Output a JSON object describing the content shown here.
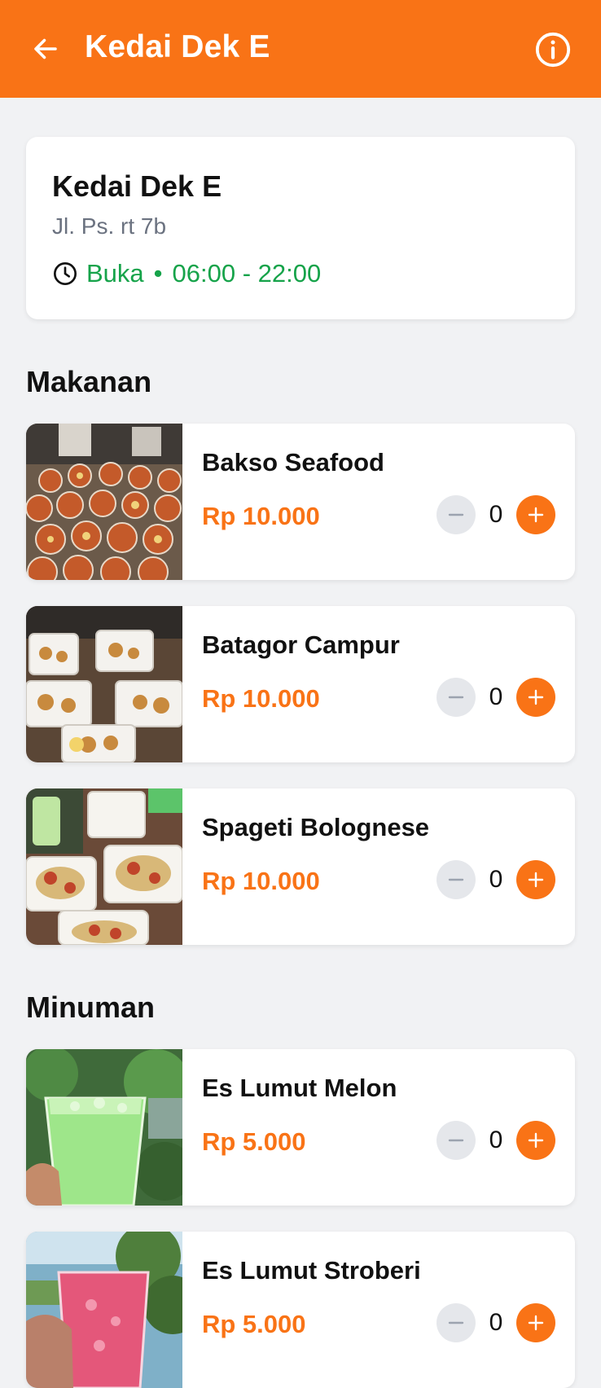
{
  "appbar": {
    "title": "Kedai Dek E",
    "back_icon": "arrow-left-icon",
    "info_icon": "info-circle-icon",
    "color": "#f97316"
  },
  "store": {
    "name": "Kedai Dek E",
    "address": "Jl. Ps. rt 7b",
    "status": "Buka",
    "separator": "•",
    "hours": "06:00 - 22:00",
    "status_color": "#16a34a"
  },
  "sections": [
    {
      "title": "Makanan",
      "items": [
        {
          "name": "Bakso Seafood",
          "price": "Rp 10.000",
          "qty": "0"
        },
        {
          "name": "Batagor Campur",
          "price": "Rp 10.000",
          "qty": "0"
        },
        {
          "name": "Spageti Bolognese",
          "price": "Rp 10.000",
          "qty": "0"
        }
      ]
    },
    {
      "title": "Minuman",
      "items": [
        {
          "name": "Es Lumut Melon",
          "price": "Rp 5.000",
          "qty": "0"
        },
        {
          "name": "Es Lumut Stroberi",
          "price": "Rp 5.000",
          "qty": "0"
        }
      ]
    }
  ],
  "stepper": {
    "minus_icon": "minus-icon",
    "plus_icon": "plus-icon"
  }
}
